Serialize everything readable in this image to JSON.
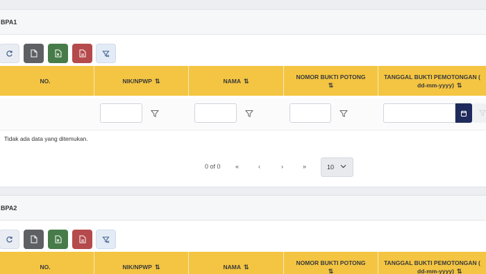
{
  "sections": [
    {
      "title": "BPA1",
      "columns": [
        {
          "line1": "NO.",
          "line2": "",
          "sortable": false
        },
        {
          "line1": "NIK/NPWP",
          "line2": "",
          "sortable": true
        },
        {
          "line1": "NAMA",
          "line2": "",
          "sortable": true
        },
        {
          "line1": "NOMOR BUKTI POTONG",
          "line2": "",
          "sortable": true
        },
        {
          "line1": "TANGGAL BUKTI PEMOTONGAN (",
          "line2": "dd-mm-yyyy)",
          "sortable": true
        }
      ],
      "empty_message": "Tidak ada data yang ditemukan.",
      "pagination": {
        "count": "0 of 0",
        "first": "«",
        "prev": "‹",
        "next": "›",
        "last": "»",
        "rows_per_page": "10"
      }
    },
    {
      "title": "BPA2",
      "columns": [
        {
          "line1": "NO.",
          "line2": "",
          "sortable": false
        },
        {
          "line1": "NIK/NPWP",
          "line2": "",
          "sortable": true
        },
        {
          "line1": "NAMA",
          "line2": "",
          "sortable": true
        },
        {
          "line1": "NOMOR BUKTI POTONG",
          "line2": "",
          "sortable": true
        },
        {
          "line1": "TANGGAL BUKTI PEMOTONGAN (",
          "line2": "dd-mm-yyyy)",
          "sortable": true
        }
      ]
    }
  ],
  "sort_glyph": "⇅",
  "toolbar_icons": [
    "refresh-icon",
    "document-icon",
    "excel-icon",
    "pdf-icon",
    "filter-icon"
  ],
  "colors": {
    "header": "#f4c542",
    "excel": "#477c4a",
    "pdf": "#b54a4c",
    "doc": "#5e6063",
    "date_button": "#1f2b5c"
  }
}
